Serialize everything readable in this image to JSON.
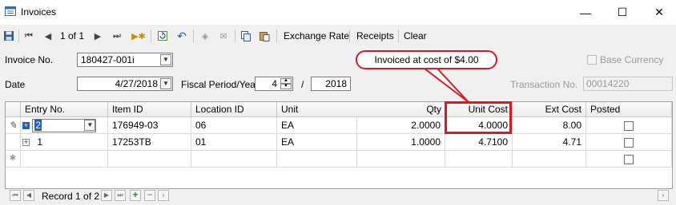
{
  "window": {
    "title": "Invoices",
    "minimize": "—",
    "maximize": "☐",
    "close": "✕"
  },
  "toolbar": {
    "record_position": "1 of 1",
    "exchange_rate": "Exchange Rate",
    "receipts": "Receipts",
    "clear": "Clear"
  },
  "form": {
    "invoice_no_label": "Invoice No.",
    "invoice_no": "180427-001i",
    "date_label": "Date",
    "date": "4/27/2018",
    "fiscal_label": "Fiscal Period/Year",
    "period": "4",
    "slash": "/",
    "year": "2018",
    "base_currency_label": "Base Currency",
    "base_currency_checked": false,
    "transaction_no_label": "Transaction No.",
    "transaction_no": "00014220"
  },
  "callout": {
    "text": "Invoiced at cost of $4.00",
    "color": "#d71921"
  },
  "grid": {
    "columns": [
      "Entry No.",
      "Item ID",
      "Location ID",
      "Unit",
      "Qty",
      "Unit Cost",
      "Ext Cost",
      "Posted"
    ],
    "rows": [
      {
        "entry": "2",
        "item": "176949-03",
        "location": "06",
        "unit": "EA",
        "qty": "2.0000",
        "unit_cost": "4.0000",
        "ext_cost": "8.00",
        "posted": false
      },
      {
        "entry": "1",
        "item": "17253TB",
        "location": "01",
        "unit": "EA",
        "qty": "1.0000",
        "unit_cost": "4.7100",
        "ext_cost": "4.71",
        "posted": false
      }
    ],
    "new_row_posted": false
  },
  "navigator": {
    "record_text": "Record 1 of 2"
  }
}
